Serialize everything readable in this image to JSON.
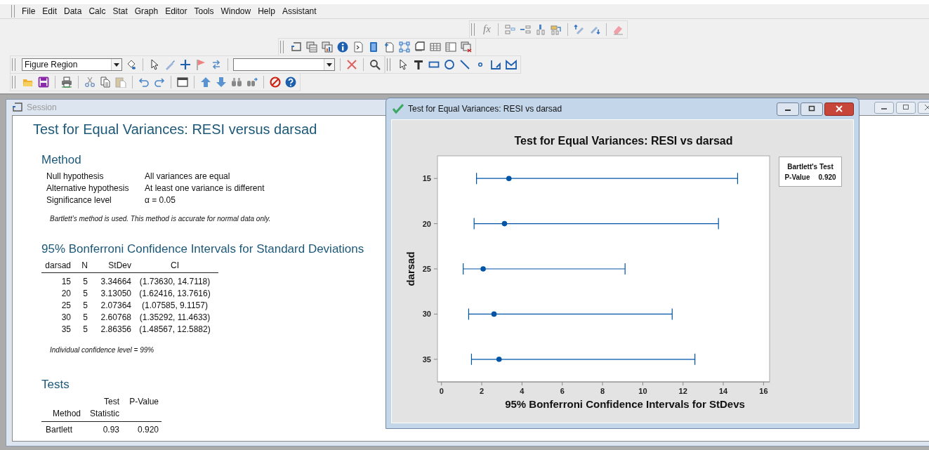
{
  "menu": [
    "File",
    "Edit",
    "Data",
    "Calc",
    "Stat",
    "Graph",
    "Editor",
    "Tools",
    "Window",
    "Help",
    "Assistant"
  ],
  "toolbar": {
    "fx_label": "fx",
    "element_selector": {
      "value": "Figure Region"
    }
  },
  "session": {
    "title": "Session",
    "report_title": "Test for Equal Variances: RESI versus darsad",
    "method": {
      "heading": "Method",
      "rows": [
        {
          "label": "Null hypothesis",
          "value": "All variances are equal"
        },
        {
          "label": "Alternative hypothesis",
          "value": "At least one variance is different"
        },
        {
          "label": "Significance level",
          "value": "α = 0.05"
        }
      ],
      "note": "Bartlett’s method is used. This method is accurate for normal data only."
    },
    "intervals": {
      "heading": "95% Bonferroni Confidence Intervals for Standard Deviations",
      "columns": [
        "darsad",
        "N",
        "StDev",
        "CI"
      ],
      "rows": [
        [
          "15",
          "5",
          "3.34664",
          "(1.73630, 14.7118)"
        ],
        [
          "20",
          "5",
          "3.13050",
          "(1.62416, 13.7616)"
        ],
        [
          "25",
          "5",
          "2.07364",
          "(1.07585, 9.1157)"
        ],
        [
          "30",
          "5",
          "2.60768",
          "(1.35292, 11.4633)"
        ],
        [
          "35",
          "5",
          "2.86356",
          "(1.48567, 12.5882)"
        ]
      ],
      "note": "Individual confidence level = 99%"
    },
    "tests": {
      "heading": "Tests",
      "columns": [
        {
          "lines": [
            "Method"
          ]
        },
        {
          "lines": [
            "Test",
            "Statistic"
          ]
        },
        {
          "lines": [
            "P-Value"
          ]
        }
      ],
      "rows": [
        [
          "Bartlett",
          "0.93",
          "0.920"
        ]
      ]
    }
  },
  "graph_window": {
    "title": "Test for Equal Variances: RESI vs darsad",
    "chart_data": {
      "type": "scatter",
      "orientation": "horizontal",
      "title": "Test for Equal Variances: RESI vs darsad",
      "xlabel": "95% Bonferroni Confidence Intervals for StDevs",
      "ylabel": "darsad",
      "categories": [
        "15",
        "20",
        "25",
        "30",
        "35"
      ],
      "series": [
        {
          "color": "#0054a6",
          "values": [
            3.35,
            3.13,
            2.07,
            2.61,
            2.86
          ],
          "errors": [
            [
              1.74,
              14.71
            ],
            [
              1.62,
              13.76
            ],
            [
              1.08,
              9.12
            ],
            [
              1.35,
              11.46
            ],
            [
              1.49,
              12.59
            ]
          ]
        }
      ],
      "xlim": [
        -0.2,
        16.3
      ],
      "xticks": [
        0,
        2,
        4,
        6,
        8,
        10,
        12,
        14,
        16
      ]
    },
    "legend": {
      "title": "Bartlett's Test",
      "rows": [
        {
          "label": "P-Value",
          "value": "0.920"
        }
      ]
    }
  }
}
